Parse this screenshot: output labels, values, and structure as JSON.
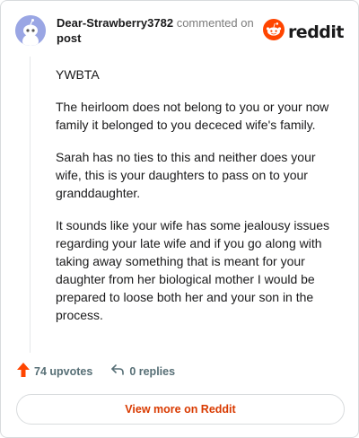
{
  "author": "Dear-Strawberry3782",
  "commented_on": "commented on",
  "post_label": "post",
  "brand": "reddit",
  "comment_paragraphs": [
    "YWBTA",
    "The heirloom does not belong to you or your now family it belonged to you dececed wife's family.",
    "Sarah has no ties to this and neither does your wife, this is your daughters to pass on to your granddaughter.",
    "It sounds like your wife has some jealousy issues regarding your late wife and if you go along with taking away something that is meant for your daughter from her biological mother I would be prepared to loose both her and your son in the process."
  ],
  "upvotes": "74 upvotes",
  "replies": "0 replies",
  "view_more": "View more on Reddit",
  "colors": {
    "accent": "#ff4500",
    "link_orange": "#d93a00",
    "avatar_bg": "#9aa6e4",
    "muted": "#576f76"
  },
  "icons": {
    "avatar": "snoo-avatar-icon",
    "brand": "reddit-logo-icon",
    "upvote": "upvote-arrow-icon",
    "reply": "reply-arrow-icon"
  }
}
